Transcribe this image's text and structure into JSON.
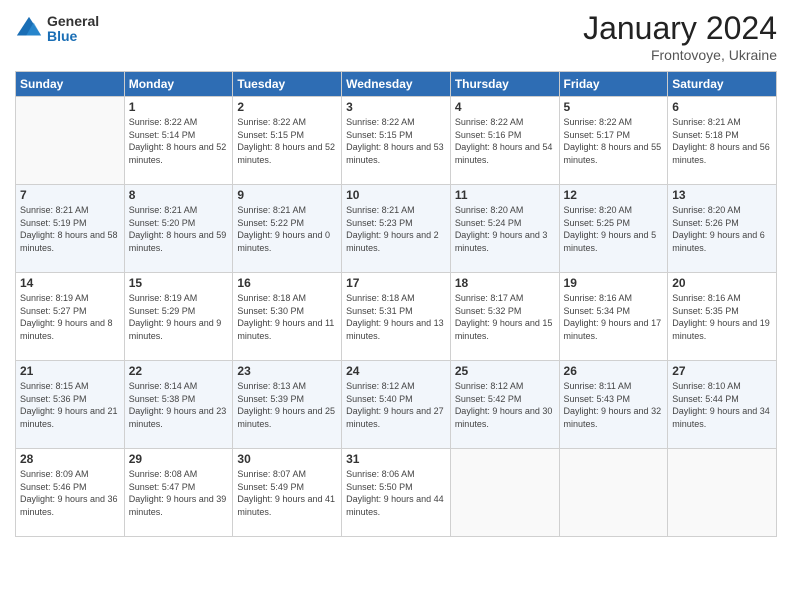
{
  "logo": {
    "general": "General",
    "blue": "Blue"
  },
  "header": {
    "month": "January 2024",
    "location": "Frontovoye, Ukraine"
  },
  "weekdays": [
    "Sunday",
    "Monday",
    "Tuesday",
    "Wednesday",
    "Thursday",
    "Friday",
    "Saturday"
  ],
  "weeks": [
    [
      null,
      {
        "day": 1,
        "sunrise": "8:22 AM",
        "sunset": "5:14 PM",
        "daylight": "8 hours and 52 minutes."
      },
      {
        "day": 2,
        "sunrise": "8:22 AM",
        "sunset": "5:15 PM",
        "daylight": "8 hours and 52 minutes."
      },
      {
        "day": 3,
        "sunrise": "8:22 AM",
        "sunset": "5:15 PM",
        "daylight": "8 hours and 53 minutes."
      },
      {
        "day": 4,
        "sunrise": "8:22 AM",
        "sunset": "5:16 PM",
        "daylight": "8 hours and 54 minutes."
      },
      {
        "day": 5,
        "sunrise": "8:22 AM",
        "sunset": "5:17 PM",
        "daylight": "8 hours and 55 minutes."
      },
      {
        "day": 6,
        "sunrise": "8:21 AM",
        "sunset": "5:18 PM",
        "daylight": "8 hours and 56 minutes."
      }
    ],
    [
      {
        "day": 7,
        "sunrise": "8:21 AM",
        "sunset": "5:19 PM",
        "daylight": "8 hours and 58 minutes."
      },
      {
        "day": 8,
        "sunrise": "8:21 AM",
        "sunset": "5:20 PM",
        "daylight": "8 hours and 59 minutes."
      },
      {
        "day": 9,
        "sunrise": "8:21 AM",
        "sunset": "5:22 PM",
        "daylight": "9 hours and 0 minutes."
      },
      {
        "day": 10,
        "sunrise": "8:21 AM",
        "sunset": "5:23 PM",
        "daylight": "9 hours and 2 minutes."
      },
      {
        "day": 11,
        "sunrise": "8:20 AM",
        "sunset": "5:24 PM",
        "daylight": "9 hours and 3 minutes."
      },
      {
        "day": 12,
        "sunrise": "8:20 AM",
        "sunset": "5:25 PM",
        "daylight": "9 hours and 5 minutes."
      },
      {
        "day": 13,
        "sunrise": "8:20 AM",
        "sunset": "5:26 PM",
        "daylight": "9 hours and 6 minutes."
      }
    ],
    [
      {
        "day": 14,
        "sunrise": "8:19 AM",
        "sunset": "5:27 PM",
        "daylight": "9 hours and 8 minutes."
      },
      {
        "day": 15,
        "sunrise": "8:19 AM",
        "sunset": "5:29 PM",
        "daylight": "9 hours and 9 minutes."
      },
      {
        "day": 16,
        "sunrise": "8:18 AM",
        "sunset": "5:30 PM",
        "daylight": "9 hours and 11 minutes."
      },
      {
        "day": 17,
        "sunrise": "8:18 AM",
        "sunset": "5:31 PM",
        "daylight": "9 hours and 13 minutes."
      },
      {
        "day": 18,
        "sunrise": "8:17 AM",
        "sunset": "5:32 PM",
        "daylight": "9 hours and 15 minutes."
      },
      {
        "day": 19,
        "sunrise": "8:16 AM",
        "sunset": "5:34 PM",
        "daylight": "9 hours and 17 minutes."
      },
      {
        "day": 20,
        "sunrise": "8:16 AM",
        "sunset": "5:35 PM",
        "daylight": "9 hours and 19 minutes."
      }
    ],
    [
      {
        "day": 21,
        "sunrise": "8:15 AM",
        "sunset": "5:36 PM",
        "daylight": "9 hours and 21 minutes."
      },
      {
        "day": 22,
        "sunrise": "8:14 AM",
        "sunset": "5:38 PM",
        "daylight": "9 hours and 23 minutes."
      },
      {
        "day": 23,
        "sunrise": "8:13 AM",
        "sunset": "5:39 PM",
        "daylight": "9 hours and 25 minutes."
      },
      {
        "day": 24,
        "sunrise": "8:12 AM",
        "sunset": "5:40 PM",
        "daylight": "9 hours and 27 minutes."
      },
      {
        "day": 25,
        "sunrise": "8:12 AM",
        "sunset": "5:42 PM",
        "daylight": "9 hours and 30 minutes."
      },
      {
        "day": 26,
        "sunrise": "8:11 AM",
        "sunset": "5:43 PM",
        "daylight": "9 hours and 32 minutes."
      },
      {
        "day": 27,
        "sunrise": "8:10 AM",
        "sunset": "5:44 PM",
        "daylight": "9 hours and 34 minutes."
      }
    ],
    [
      {
        "day": 28,
        "sunrise": "8:09 AM",
        "sunset": "5:46 PM",
        "daylight": "9 hours and 36 minutes."
      },
      {
        "day": 29,
        "sunrise": "8:08 AM",
        "sunset": "5:47 PM",
        "daylight": "9 hours and 39 minutes."
      },
      {
        "day": 30,
        "sunrise": "8:07 AM",
        "sunset": "5:49 PM",
        "daylight": "9 hours and 41 minutes."
      },
      {
        "day": 31,
        "sunrise": "8:06 AM",
        "sunset": "5:50 PM",
        "daylight": "9 hours and 44 minutes."
      },
      null,
      null,
      null
    ]
  ]
}
